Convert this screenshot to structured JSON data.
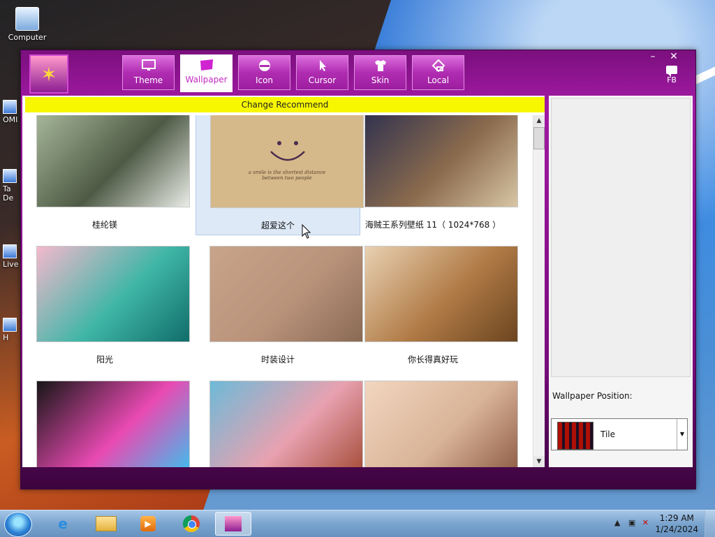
{
  "desktop": {
    "icons": [
      {
        "label": "Computer"
      }
    ],
    "partial_labels": [
      "OMI",
      "Ta",
      "De",
      "Live",
      "H"
    ]
  },
  "window": {
    "tabs": [
      {
        "label": "Theme",
        "icon": "monitor-icon"
      },
      {
        "label": "Wallpaper",
        "icon": "wallpaper-icon",
        "active": true
      },
      {
        "label": "Icon",
        "icon": "icon-tab-icon"
      },
      {
        "label": "Cursor",
        "icon": "cursor-icon"
      },
      {
        "label": "Skin",
        "icon": "shirt-icon"
      },
      {
        "label": "Local",
        "icon": "local-icon"
      }
    ],
    "controls": {
      "minimize": "–",
      "close": "✕"
    },
    "feedback_label": "FB",
    "banner": "Change Recommend",
    "wallpapers": [
      {
        "caption": "桂纶镁",
        "colors": [
          "#a7b89a",
          "#4e5a45",
          "#e9ece6"
        ]
      },
      {
        "caption": "超爱这个",
        "colors": [
          "#d6b98a",
          "#c7a574",
          "#b79562"
        ],
        "selected": true,
        "thumb_text": "a smile is the shortest distance between two people"
      },
      {
        "caption": "海贼王系列壁纸 11（ 1024*768 ）",
        "colors": [
          "#30324f",
          "#8b6b4d",
          "#d8c6a4"
        ]
      },
      {
        "caption": "阳光",
        "colors": [
          "#f4b8cc",
          "#3fb6a7",
          "#116d6a"
        ]
      },
      {
        "caption": "时装设计",
        "colors": [
          "#c8a48a",
          "#b9927a",
          "#8a6a55"
        ]
      },
      {
        "caption": "你长得真好玩",
        "colors": [
          "#e8d1b2",
          "#b07a45",
          "#6b4520"
        ]
      },
      {
        "caption": "",
        "colors": [
          "#161616",
          "#e94ab2",
          "#37c3f0"
        ]
      },
      {
        "caption": "",
        "colors": [
          "#6dbad8",
          "#e8a1b0",
          "#a34a34"
        ]
      },
      {
        "caption": "",
        "colors": [
          "#f2d6bf",
          "#d8b397",
          "#8c5a44"
        ]
      }
    ],
    "side": {
      "position_label": "Wallpaper Position:",
      "position_value": "Tile"
    }
  },
  "taskbar": {
    "clock_time": "1:29 AM",
    "clock_date": "1/24/2024",
    "apps": [
      "internet-explorer-icon",
      "file-explorer-icon",
      "media-player-icon",
      "chrome-icon",
      "theme-app-icon"
    ]
  },
  "colors": {
    "window_accent": "#a11aa3",
    "banner": "#f7f700"
  }
}
